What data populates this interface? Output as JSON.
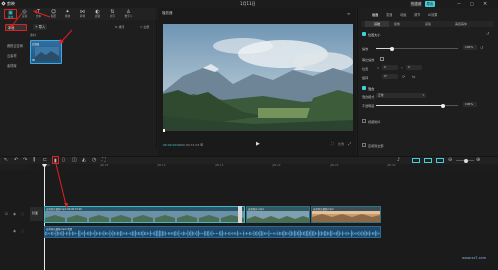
{
  "app": {
    "name": "剪映",
    "title": "1月11日"
  },
  "titlebar_buttons": {
    "shortcut": "快捷键",
    "export": "导出"
  },
  "toolbar": {
    "items": [
      {
        "label": "媒体",
        "icon": "media-icon"
      },
      {
        "label": "音频",
        "icon": "audio-icon"
      },
      {
        "label": "文本",
        "icon": "text-icon"
      },
      {
        "label": "贴纸",
        "icon": "sticker-icon"
      },
      {
        "label": "特效",
        "icon": "effects-icon"
      },
      {
        "label": "转场",
        "icon": "transition-icon"
      },
      {
        "label": "滤镜",
        "icon": "filter-icon"
      },
      {
        "label": "调节",
        "icon": "adjust-icon"
      },
      {
        "label": "数字人",
        "icon": "avatar-icon"
      }
    ]
  },
  "left_panel": {
    "sidebar": [
      "本地",
      "我的云空间",
      "云素材",
      "素材库"
    ],
    "import_label": "导入",
    "header_sort": "排序",
    "header_all": "全部",
    "section_label": "素材",
    "clip_caption": "已添加",
    "clip_duration": "00:01:20"
  },
  "player": {
    "title": "播放器",
    "time_current": "00:00:00:00",
    "time_total": "00:00:31:03",
    "aspect_label": "比例"
  },
  "inspector": {
    "tabs": [
      "画面",
      "变速",
      "动画",
      "调节",
      "AI效果"
    ],
    "subtabs": [
      "基础",
      "抠像",
      "蒙版",
      "美颜美体"
    ],
    "position_size": "位置大小",
    "scale_label": "缩放",
    "scale_value": "100%",
    "uniform_scale": "等比缩放",
    "position_label": "位置",
    "pos_x": "0",
    "pos_y": "0",
    "rotate_label": "旋转",
    "rotate_value": "0°",
    "blend_label": "混合",
    "blend_mode_label": "混合模式",
    "blend_mode_value": "正常",
    "opacity_label": "不透明度",
    "opacity_value": "100%",
    "opacity_fraction": 0.82,
    "scale_fraction": 0.2,
    "stabilize": "视频防抖",
    "bottom_btn": "应用到全部"
  },
  "timeline": {
    "ruler": [
      "00:00",
      "|00:05",
      "|00:10",
      "|00:15",
      "|00:20",
      "|00:25",
      "|00:30"
    ],
    "track_cover": "封面",
    "video_clips": [
      {
        "label": "自然风光视频.mp4  00:00:15:00"
      },
      {
        "label": "自然风光.mp4"
      },
      {
        "label": "自然风光视频.mp4"
      }
    ],
    "audio_label": "自然风光视频.mp4  音频"
  },
  "watermark": "www.xz7.com",
  "colors": {
    "accent": "#3fd0d8",
    "annotation": "#e02020",
    "clip_border": "#3fb9c8"
  }
}
